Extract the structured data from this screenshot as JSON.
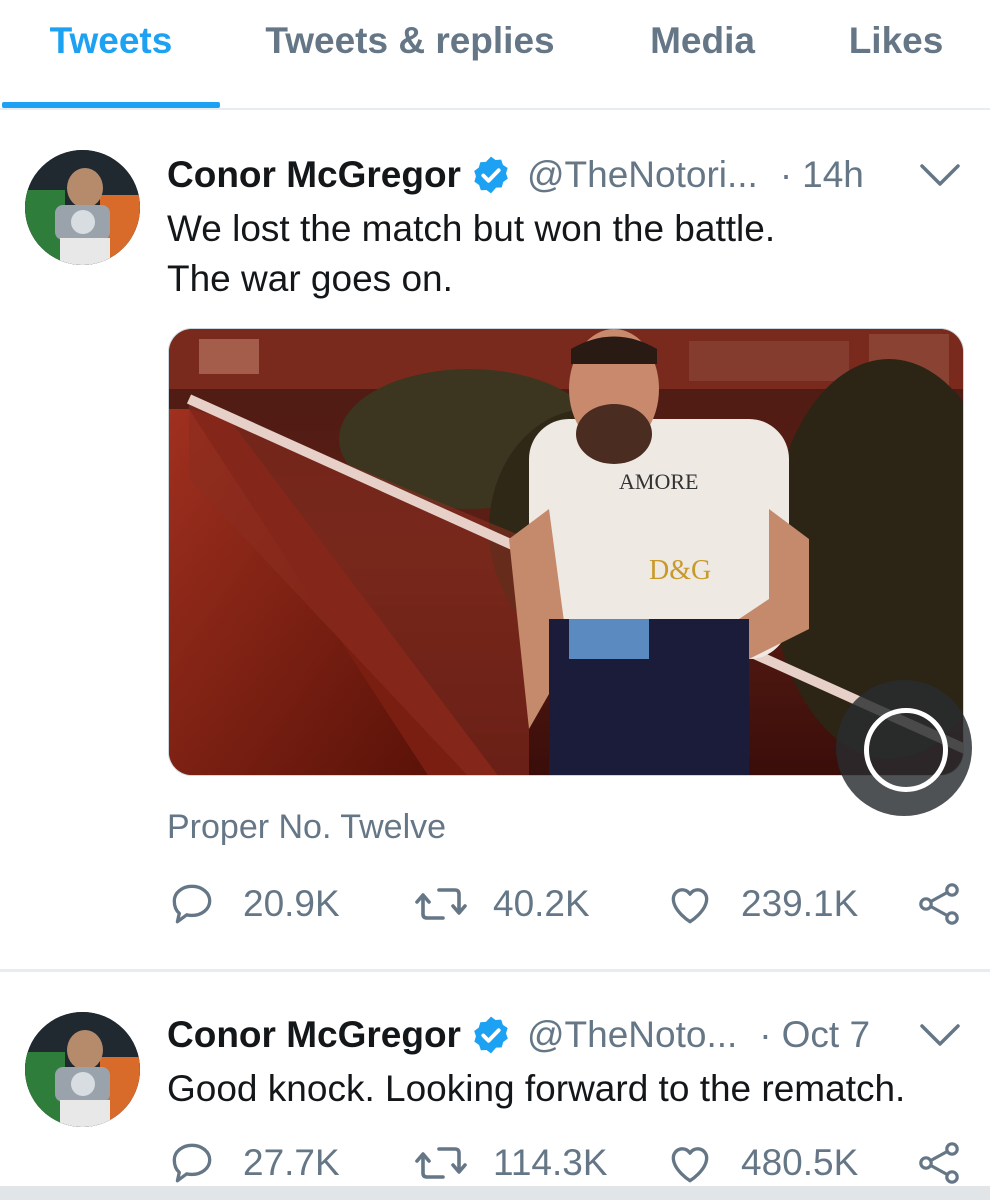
{
  "tabs": [
    {
      "label": "Tweets",
      "active": true
    },
    {
      "label": "Tweets & replies",
      "active": false
    },
    {
      "label": "Media",
      "active": false
    },
    {
      "label": "Likes",
      "active": false
    }
  ],
  "colors": {
    "accent": "#1da1f2",
    "muted": "#657786",
    "text": "#14171a",
    "like_outline": "#657786"
  },
  "tweets": [
    {
      "name": "Conor McGregor",
      "verified": true,
      "handle": "@TheNotori...",
      "separator": "·",
      "time": "14h",
      "text_lines": [
        "We lost the match but won the battle.",
        "The war goes on."
      ],
      "media_icon": "photo-thumbnail",
      "source": "Proper No. Twelve",
      "actions": {
        "replies": "20.9K",
        "retweets": "40.2K",
        "likes": "239.1K"
      }
    },
    {
      "name": "Conor McGregor",
      "verified": true,
      "handle": "@TheNoto...",
      "separator": "·",
      "time": "Oct 7",
      "text_lines": [
        "Good knock. Looking forward to the rematch."
      ],
      "actions": {
        "replies": "27.7K",
        "retweets": "114.3K",
        "likes": "480.5K"
      }
    }
  ],
  "icons": [
    "verified-badge-icon",
    "chevron-down-icon",
    "reply-icon",
    "retweet-icon",
    "like-icon",
    "share-icon",
    "touch-indicator-icon"
  ]
}
